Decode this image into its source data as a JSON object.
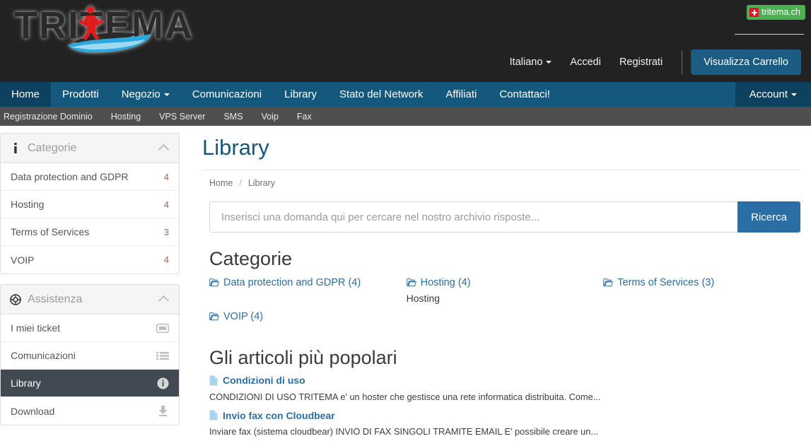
{
  "brand": {
    "logo_text": "TRITEMA",
    "badge_label": "tritema.ch",
    "badge_color": "#4caf50",
    "flag_color": "#e8112d"
  },
  "header": {
    "language": "Italiano",
    "login": "Accedi",
    "register": "Registrati",
    "cart_button": "Visualizza Carrello",
    "cart_color": "#1b5b84"
  },
  "mainnav": {
    "accent": "#15587d",
    "active_color": "#0d415f",
    "items": [
      {
        "label": "Home",
        "active": true,
        "caret": false
      },
      {
        "label": "Prodotti",
        "active": false,
        "caret": false
      },
      {
        "label": "Negozio",
        "active": false,
        "caret": true
      },
      {
        "label": "Comunicazioni",
        "active": false,
        "caret": false
      },
      {
        "label": "Library",
        "active": false,
        "caret": false
      },
      {
        "label": "Stato del Network",
        "active": false,
        "caret": false
      },
      {
        "label": "Affiliati",
        "active": false,
        "caret": false
      },
      {
        "label": "Contattaci!",
        "active": false,
        "caret": false
      }
    ],
    "account": "Account"
  },
  "subnav": {
    "background": "#4f4f4f",
    "items": [
      "Registrazione Dominio",
      "Hosting",
      "VPS Server",
      "SMS",
      "Voip",
      "Fax"
    ]
  },
  "sidebar": {
    "categories_panel": {
      "title": "Categorie",
      "icon": "info-icon",
      "rows": [
        {
          "label": "Data protection and GDPR",
          "count": "4"
        },
        {
          "label": "Hosting",
          "count": "4"
        },
        {
          "label": "Terms of Services",
          "count": "3"
        },
        {
          "label": "VOIP",
          "count": "4"
        }
      ]
    },
    "support_panel": {
      "title": "Assistenza",
      "icon": "lifebuoy-icon",
      "rows": [
        {
          "label": "I miei ticket",
          "icon": "ticket-icon",
          "selected": false
        },
        {
          "label": "Comunicazioni",
          "icon": "list-icon",
          "selected": false
        },
        {
          "label": "Library",
          "icon": "info-circle-icon",
          "selected": true
        },
        {
          "label": "Download",
          "icon": "download-icon",
          "selected": false
        }
      ]
    }
  },
  "main": {
    "title": "Library",
    "breadcrumb": {
      "home": "Home",
      "separator": "/",
      "current": "Library"
    },
    "search": {
      "placeholder": "Inserisci una domanda qui per cercare nel nostro archivio risposte...",
      "value": "",
      "button": "Ricerca",
      "button_color": "#2b6ea5"
    },
    "categories_heading": "Categorie",
    "categories": [
      {
        "label": "Data protection and GDPR (4)",
        "desc": ""
      },
      {
        "label": "Hosting (4)",
        "desc": "Hosting"
      },
      {
        "label": "Terms of Services (3)",
        "desc": ""
      },
      {
        "label": "VOIP (4)",
        "desc": ""
      }
    ],
    "articles_heading": "Gli articoli più popolari",
    "articles": [
      {
        "title": "Condizioni di uso",
        "excerpt": "CONDIZIONI DI USO TRITEMA e' un hoster che gestisce una rete informatica distribuita.  Come..."
      },
      {
        "title": "Invio fax con Cloudbear",
        "excerpt": "Inviare fax (sistema cloudbear)  INVIO DI FAX SINGOLI TRAMITE EMAIL E' possibile creare un..."
      }
    ]
  }
}
